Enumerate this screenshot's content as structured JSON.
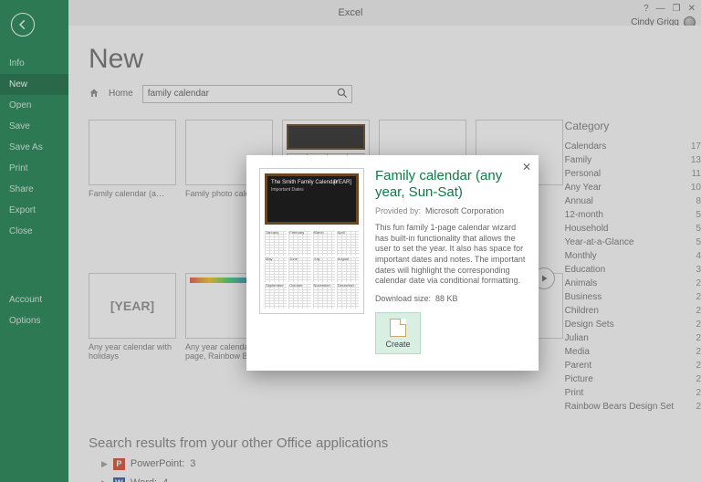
{
  "app_title": "Excel",
  "user_name": "Cindy Grigg",
  "window_controls": {
    "help": "?",
    "min": "—",
    "restore": "❐",
    "close": "✕"
  },
  "sidebar": {
    "items": [
      {
        "label": "Info"
      },
      {
        "label": "New"
      },
      {
        "label": "Open"
      },
      {
        "label": "Save"
      },
      {
        "label": "Save As"
      },
      {
        "label": "Print"
      },
      {
        "label": "Share"
      },
      {
        "label": "Export"
      },
      {
        "label": "Close"
      }
    ],
    "bottom": [
      {
        "label": "Account"
      },
      {
        "label": "Options"
      }
    ],
    "selected": "New"
  },
  "page": {
    "heading": "New",
    "breadcrumb_home": "Home",
    "search_value": "family calendar"
  },
  "templates": [
    {
      "caption": "Family calendar (a…"
    },
    {
      "caption": "Family photo calendar"
    },
    {
      "caption": ""
    },
    {
      "caption": ""
    },
    {
      "caption": ""
    },
    {
      "caption": "Any year calendar with holidays"
    },
    {
      "caption": "Any year calendar (1 page, Rainbow Be…"
    },
    {
      "caption": ""
    },
    {
      "caption": ""
    },
    {
      "caption": ""
    }
  ],
  "other_apps": {
    "heading": "Search results from your other Office applications",
    "rows": [
      {
        "app": "PowerPoint",
        "count": 3,
        "icon": "P"
      },
      {
        "app": "Word",
        "count": 4,
        "icon": "W"
      }
    ]
  },
  "category": {
    "heading": "Category",
    "items": [
      {
        "label": "Calendars",
        "count": 17
      },
      {
        "label": "Family",
        "count": 13
      },
      {
        "label": "Personal",
        "count": 11
      },
      {
        "label": "Any Year",
        "count": 10
      },
      {
        "label": "Annual",
        "count": 8
      },
      {
        "label": "12-month",
        "count": 5
      },
      {
        "label": "Household",
        "count": 5
      },
      {
        "label": "Year-at-a-Glance",
        "count": 5
      },
      {
        "label": "Monthly",
        "count": 4
      },
      {
        "label": "Education",
        "count": 3
      },
      {
        "label": "Animals",
        "count": 2
      },
      {
        "label": "Business",
        "count": 2
      },
      {
        "label": "Children",
        "count": 2
      },
      {
        "label": "Design Sets",
        "count": 2
      },
      {
        "label": "Julian",
        "count": 2
      },
      {
        "label": "Media",
        "count": 2
      },
      {
        "label": "Parent",
        "count": 2
      },
      {
        "label": "Picture",
        "count": 2
      },
      {
        "label": "Print",
        "count": 2
      },
      {
        "label": "Rainbow Bears Design Set",
        "count": 2
      }
    ]
  },
  "dialog": {
    "title": "Family calendar (any year, Sun-Sat)",
    "provided_by_label": "Provided by:",
    "provided_by_value": "Microsoft Corporation",
    "description": "This fun family 1-page calendar wizard has built-in functionality that allows the user to set the year. It also has space for important dates and notes. The important dates will highlight the corresponding calendar date via conditional formatting.",
    "download_label": "Download size:",
    "download_value": "88 KB",
    "create_label": "Create",
    "preview": {
      "title": "The Smith Family Calendar",
      "subtitle": "Important Dates",
      "year": "[YEAR]",
      "months": [
        "January",
        "February",
        "March",
        "April",
        "May",
        "June",
        "July",
        "August",
        "September",
        "October",
        "November",
        "December"
      ]
    }
  }
}
